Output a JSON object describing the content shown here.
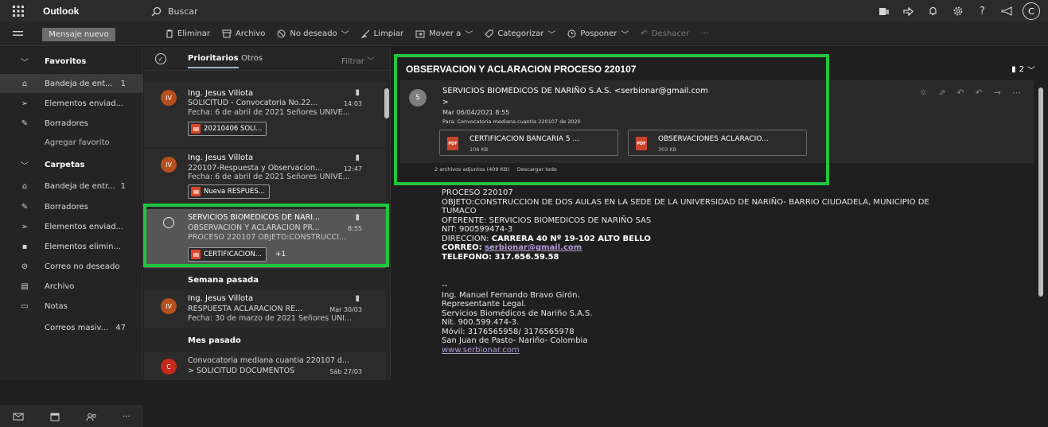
{
  "topbar": {
    "app_name": "Outlook",
    "search_placeholder": "Buscar",
    "avatar_initial": "C",
    "icons": [
      "teams-icon",
      "share-icon",
      "bell-icon",
      "gear-icon",
      "help-icon",
      "megaphone-icon"
    ],
    "help_glyph": "?"
  },
  "command_bar": {
    "new_message": "Mensaje nuevo",
    "delete": "Eliminar",
    "archive": "Archivo",
    "junk": "No deseado",
    "sweep": "Limpiar",
    "move": "Mover a",
    "categorize": "Categorizar",
    "snooze": "Posponer",
    "undo": "Deshacer",
    "more": "···"
  },
  "sidebar": {
    "favorites_header": "Favoritos",
    "favorites": [
      {
        "label": "Bandeja de ent...",
        "count": "1",
        "icon": "inbox-icon"
      },
      {
        "label": "Elementos enviad...",
        "count": "",
        "icon": "send-icon"
      },
      {
        "label": "Borradores",
        "count": "",
        "icon": "draft-icon"
      }
    ],
    "add_favorite": "Agregar favorito",
    "folders_header": "Carpetas",
    "folders": [
      {
        "label": "Bandeja de entr...",
        "count": "1",
        "icon": "inbox-icon"
      },
      {
        "label": "Borradores",
        "count": "",
        "icon": "draft-icon"
      },
      {
        "label": "Elementos enviad...",
        "count": "",
        "icon": "send-icon"
      },
      {
        "label": "Elementos elimin...",
        "count": "",
        "icon": "trash-icon"
      },
      {
        "label": "Correo no deseado",
        "count": "",
        "icon": "junk-icon"
      },
      {
        "label": "Archivo",
        "count": "",
        "icon": "archive-icon"
      },
      {
        "label": "Notas",
        "count": "",
        "icon": "notes-icon"
      },
      {
        "label": "Correos masiv...",
        "count": "47",
        "icon": ""
      }
    ],
    "footer_icons": [
      "mail-icon",
      "calendar-icon",
      "people-icon",
      "more-icon"
    ],
    "footer_more": "···"
  },
  "message_list": {
    "tab_focused": "Prioritarios",
    "tab_other": "Otros",
    "filter": "Filtrar",
    "messages": [
      {
        "initials": "IV",
        "avatar_color": "#b5501e",
        "sender": "Ing. Jesus Villota",
        "subject": "SOLICITUD - Convocatoria No.22...",
        "time": "14:03",
        "preview": "Fecha: 6 de abril de 2021 Señores UNIVE...",
        "attachment": "20210406 SOLI...",
        "extra": ""
      },
      {
        "initials": "IV",
        "avatar_color": "#b5501e",
        "sender": "Ing. Jesus Villota",
        "subject": "220107-Respuesta y Observacion...",
        "time": "12:47",
        "preview": "Fecha: 6 de abril de 2021 Señores UNIVE...",
        "attachment": "Nueva RESPUES...",
        "extra": ""
      },
      {
        "initials": "",
        "avatar_color": "",
        "sender": "SERVICIOS BIOMEDICOS DE NARI...",
        "subject": "OBSERVACION Y ACLARACION PR...",
        "time": "8:55",
        "preview": "PROCESO 220107 OBJETO:CONSTRUCCI...",
        "attachment": "CERTIFICACION...",
        "extra": "+1"
      }
    ],
    "section_last_week": "Semana pasada",
    "last_week": {
      "initials": "IV",
      "avatar_color": "#b5501e",
      "sender": "Ing. Jesus Villota",
      "subject": "RESPUESTA ACLARACION RE...",
      "time": "Mar 30/03",
      "preview": "Fecha: 30 de marzo de 2021 Señores UNI..."
    },
    "section_last_month": "Mes pasado",
    "last_month": {
      "initials": "C",
      "avatar_color": "#c42b1c",
      "subject_line": "Convocatoria mediana cuantia 220107 d...",
      "line2": "> SOLICITUD DOCUMENTOS",
      "time": "Sáb 27/03"
    }
  },
  "reading_pane": {
    "title": "OBSERVACION Y ACLARACION PROCESO 220107",
    "thread_count": "2",
    "avatar_initial": "S",
    "from": "SERVICIOS BIOMEDICOS DE NARIÑO S.A.S. <serbionar@gmail.com",
    "from_cont": ">",
    "date": "Mar 06/04/2021 8:55",
    "to": "Para: Convocatoria mediana cuantia 220107 de 2020",
    "attachments": [
      {
        "name": "CERTIFICACION BANCARIA 5 ...",
        "size": "106 KB",
        "badge": "PDF"
      },
      {
        "name": "OBSERVACIONES ACLARACIO...",
        "size": "303 KB",
        "badge": "PDF"
      }
    ],
    "attachment_summary": "2 archivos adjuntos (409 KB)",
    "download_all": "Descargar todo",
    "body_lines": [
      {
        "text": "PROCESO 220107",
        "style": "normal"
      },
      {
        "text": "OBJETO:CONSTRUCCION DE DOS AULAS EN LA SEDE DE LA UNIVERSIDAD DE NARIÑO- BARRIO CIUDADELA, MUNICIPIO DE",
        "style": "normal"
      },
      {
        "text": "TUMACO",
        "style": "normal"
      },
      {
        "text": "OFERENTE: SERVICIOS BIOMEDICOS DE NARIÑO SAS",
        "style": "normal"
      },
      {
        "text": "NIT: 900599474-3",
        "style": "normal"
      },
      {
        "text": "DIRECCION: ",
        "bold": "CARRERA 40 Nº 19-102 ALTO BELLO",
        "style": "mixed"
      },
      {
        "text": "CORREO: ",
        "link": "serbionar@gmail.com",
        "style": "bold-link"
      },
      {
        "text": "TELEFONO: 317.656.59.58",
        "style": "bold"
      }
    ],
    "signature_sep": "--",
    "signature": [
      "Ing. Manuel Fernando Bravo Girón.",
      "Representante Legal.",
      "Servicios Biomédicos de Nariño S.A.S.",
      "Nit. 900.599.474-3.",
      "Móvil: 3176565958/ 3176565978",
      "San Juan de Pasto- Nariño- Colombia"
    ],
    "website": "www.serbionar.com"
  },
  "colors": {
    "highlight": "#20c540",
    "link": "#b19cd9",
    "selected_row": "#565656"
  }
}
